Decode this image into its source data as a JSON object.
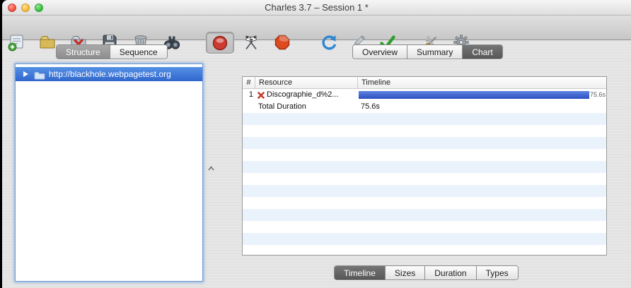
{
  "window": {
    "title": "Charles 3.7 – Session 1 *"
  },
  "traffic_lights": [
    "close",
    "minimize",
    "zoom"
  ],
  "toolbar": {
    "buttons": [
      {
        "name": "new-session"
      },
      {
        "name": "open-session"
      },
      {
        "name": "close-session"
      },
      {
        "name": "save-session"
      },
      {
        "name": "clear-session"
      },
      {
        "name": "find"
      },
      {
        "name": "record",
        "state": "active"
      },
      {
        "name": "throttling"
      },
      {
        "name": "breakpoints"
      },
      {
        "name": "repeat"
      },
      {
        "name": "edit",
        "state": "disabled"
      },
      {
        "name": "validate"
      },
      {
        "name": "tools"
      },
      {
        "name": "settings"
      }
    ]
  },
  "left_panel": {
    "tabs": [
      {
        "label": "Structure",
        "selected": true
      },
      {
        "label": "Sequence",
        "selected": false
      }
    ],
    "tree": {
      "items": [
        {
          "label": "http://blackhole.webpagetest.org",
          "selected": true,
          "expandable": true
        }
      ]
    }
  },
  "right_panel": {
    "tabs": [
      {
        "label": "Overview",
        "selected": false
      },
      {
        "label": "Summary",
        "selected": false
      },
      {
        "label": "Chart",
        "selected": true
      }
    ],
    "table": {
      "columns": [
        "#",
        "Resource",
        "Timeline"
      ],
      "rows": [
        {
          "num": "1",
          "icon": "error-x",
          "resource": "Discographie_d%2...",
          "timeline_value": "75.6s",
          "has_bar": true
        },
        {
          "num": "",
          "resource": "Total Duration",
          "timeline_value": "75.6s",
          "has_bar": false
        }
      ]
    },
    "bottom_tabs": [
      {
        "label": "Timeline",
        "selected": true
      },
      {
        "label": "Sizes",
        "selected": false
      },
      {
        "label": "Duration",
        "selected": false
      },
      {
        "label": "Types",
        "selected": false
      }
    ]
  },
  "colors": {
    "selection_blue": "#3b76d6",
    "timeline_bar_blue": "#2f55c4",
    "selected_tab_gray": "#5d5d5d",
    "record_red": "#cc3a31",
    "breakpoints_orange_red": "#dd4a1e",
    "validate_green": "#2f9e2a",
    "repeat_blue": "#2f86d2"
  }
}
